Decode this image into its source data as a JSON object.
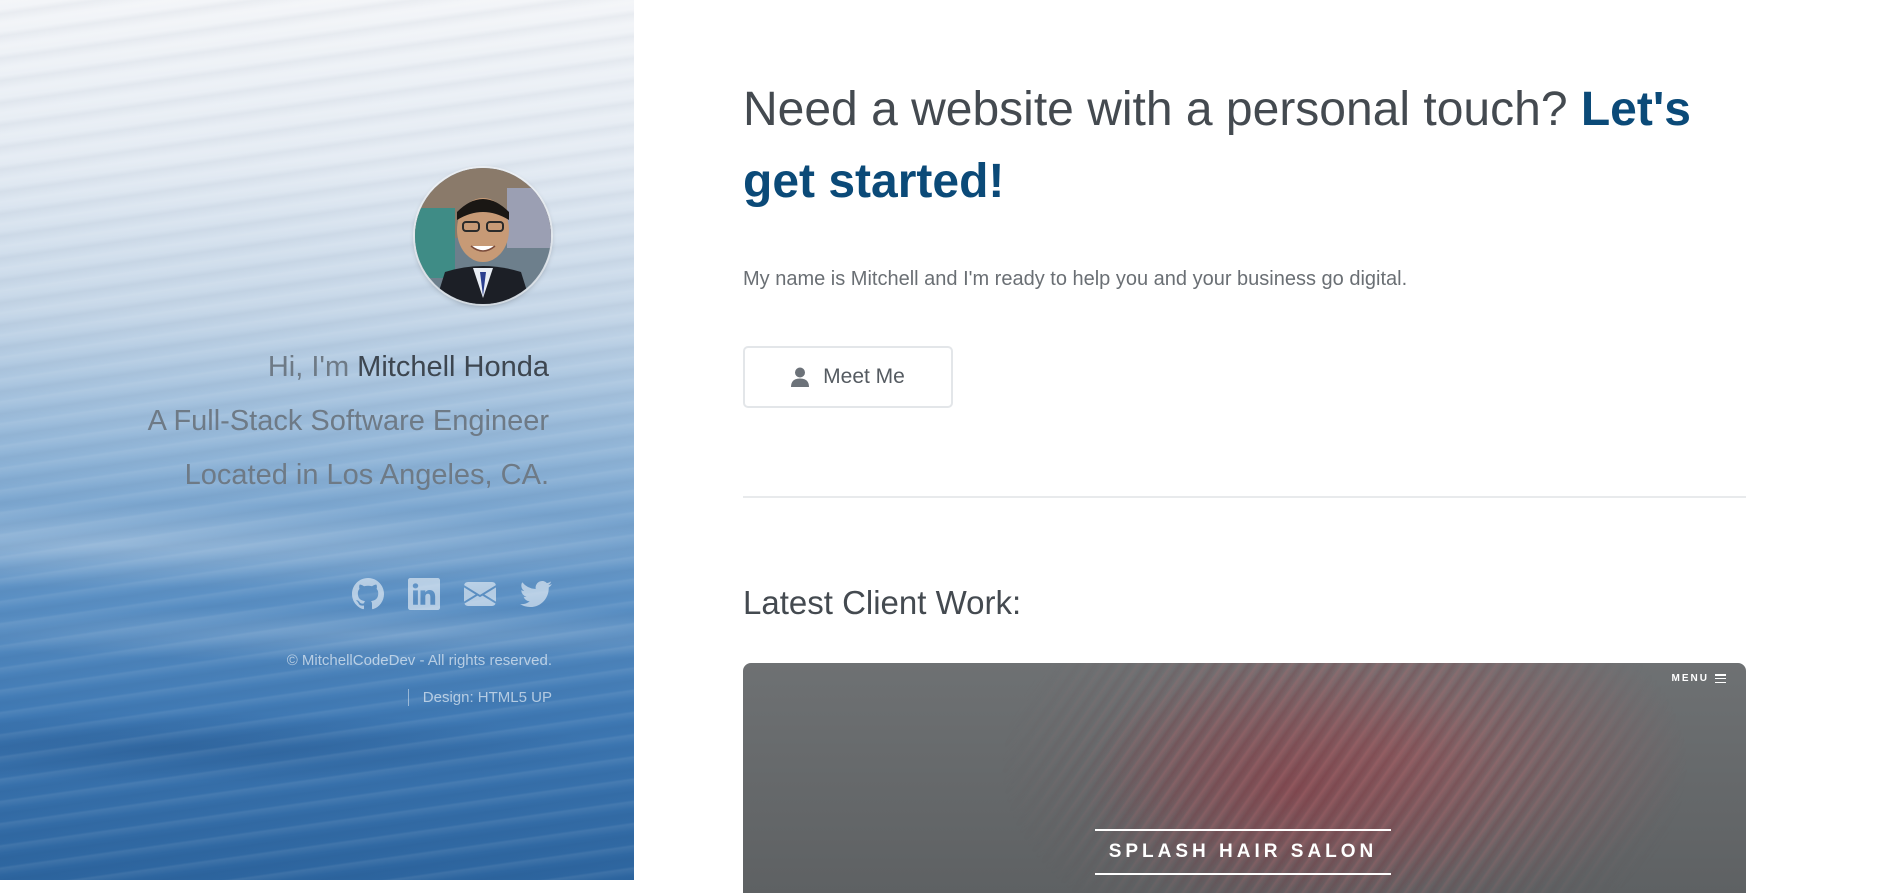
{
  "sidebar": {
    "greeting_prefix": "Hi, I'm",
    "name": "Mitchell Honda",
    "title": "A Full-Stack Software Engineer",
    "location": "Located in Los Angeles, CA.",
    "social_icons": [
      "github-icon",
      "linkedin-icon",
      "email-icon",
      "twitter-icon"
    ],
    "copyright": "© MitchellCodeDev - All rights reserved.",
    "design_credit": "Design: HTML5 UP"
  },
  "main": {
    "headline_plain": "Need a website with a personal touch?",
    "headline_cta": "Let's get started!",
    "lead": "My name is Mitchell and I'm ready to help you and your business go digital.",
    "meet_button": "Meet Me",
    "section_title": "Latest Client Work:",
    "work_card": {
      "menu_label": "MENU",
      "client_name": "SPLASH HAIR SALON"
    }
  },
  "colors": {
    "accent": "#0b4a78",
    "text_dark": "#444a50",
    "text_muted": "#6a6f74"
  }
}
